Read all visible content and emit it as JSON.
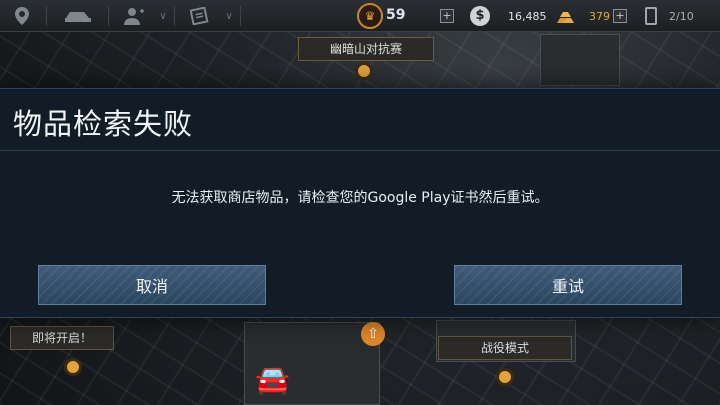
{
  "hud": {
    "level": "59",
    "cash": "16,485",
    "gold": "379",
    "fuel": "2/10",
    "plus_symbol": "+",
    "cash_symbol": "$",
    "icons": [
      "map-pin-icon",
      "garage-car-icon",
      "profile-icon",
      "chevron-down-icon",
      "news-icon",
      "chevron-down-icon",
      "crown-icon",
      "cash-icon",
      "gold-bars-icon",
      "fuel-icon"
    ],
    "accent_color": "#c9852a"
  },
  "background": {
    "event_banner": "幽暗山对抗赛",
    "coming_soon": "即将开启！",
    "campaign_mode": "战役模式"
  },
  "dialog": {
    "title": "物品检索失败",
    "message": "无法获取商店物品，请检查您的Google Play证书然后重试。",
    "cancel_label": "取消",
    "retry_label": "重试",
    "button_color": "#3f5b78"
  }
}
